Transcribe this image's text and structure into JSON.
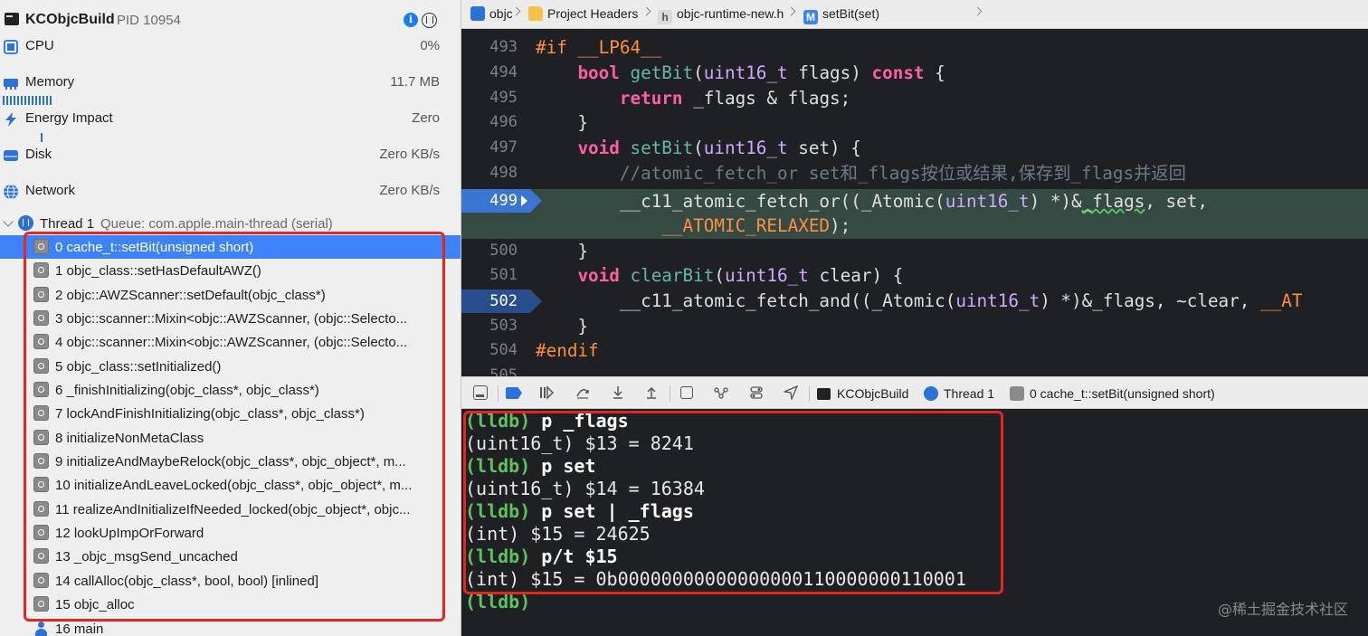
{
  "process": {
    "name": "KCObjcBuild",
    "pid": "PID 10954"
  },
  "gauges": [
    {
      "label": "CPU",
      "value": "0%",
      "icon": "cpu-icon"
    },
    {
      "label": "Memory",
      "value": "11.7 MB",
      "icon": "memory-icon"
    },
    {
      "label": "Energy Impact",
      "value": "Zero",
      "icon": "bolt-icon"
    },
    {
      "label": "Disk",
      "value": "Zero KB/s",
      "icon": "disk-icon"
    },
    {
      "label": "Network",
      "value": "Zero KB/s",
      "icon": "globe-icon"
    }
  ],
  "thread": {
    "title": "Thread 1",
    "queue": "Queue: com.apple.main-thread (serial)"
  },
  "frames": [
    "0 cache_t::setBit(unsigned short)",
    "1 objc_class::setHasDefaultAWZ()",
    "2 objc::AWZScanner::setDefault(objc_class*)",
    "3 objc::scanner::Mixin<objc::AWZScanner, (objc::Selecto...",
    "4 objc::scanner::Mixin<objc::AWZScanner, (objc::Selecto...",
    "5 objc_class::setInitialized()",
    "6 _finishInitializing(objc_class*, objc_class*)",
    "7 lockAndFinishInitializing(objc_class*, objc_class*)",
    "8 initializeNonMetaClass",
    "9 initializeAndMaybeRelock(objc_class*, objc_object*, m...",
    "10 initializeAndLeaveLocked(objc_class*, objc_object*, m...",
    "11 realizeAndInitializeIfNeeded_locked(objc_object*, objc...",
    "12 lookUpImpOrForward",
    "13 _objc_msgSend_uncached",
    "14 callAlloc(objc_class*, bool, bool) [inlined]",
    "15 objc_alloc",
    "16 main"
  ],
  "jumpbar": [
    "objc",
    "Project Headers",
    "objc-runtime-new.h",
    "setBit(set)"
  ],
  "code": {
    "line_numbers": [
      "493",
      "494",
      "495",
      "496",
      "497",
      "498",
      "499",
      "",
      "500",
      "501",
      "502",
      "503",
      "504",
      "505"
    ],
    "l493_pp": "#if __LP64__",
    "l494_kw": "bool",
    "l494_fn": "getBit",
    "l494_ty": "uint16_t",
    "l494_rest": " flags) ",
    "l494_const": "const",
    "l494_end": " {",
    "l495_kw": "return",
    "l495_rest": " _flags & flags;",
    "brace": "}",
    "l497_kw": "void",
    "l497_fn": "setBit",
    "l497_ty": "uint16_t",
    "l497_rest": " set) {",
    "l498_comment": "//atomic_fetch_or set和_flags按位或结果,保存到_flags并返回",
    "l499_a": "__c11_atomic_fetch_or((_Atomic(",
    "l499_ty": "uint16_t",
    "l499_b": ") *)&",
    "l499_u": "_flags",
    "l499_c": ", set,",
    "l499_macro": "__ATOMIC_RELAXED",
    "l499_end": ");",
    "l501_kw": "void",
    "l501_fn": "clearBit",
    "l501_ty": "uint16_t",
    "l501_rest": " clear) {",
    "l502_a": "__c11_atomic_fetch_and((_Atomic(",
    "l502_ty": "uint16_t",
    "l502_b": ") *)&_flags, ~clear, ",
    "l502_macro": "__AT",
    "l504_pp": "#endif"
  },
  "debugbar": {
    "process": "KCObjcBuild",
    "thread": "Thread 1",
    "frame": "0 cache_t::setBit(unsigned short)"
  },
  "console": {
    "prompt": "(lldb)",
    "cmd1": " p _flags",
    "out1": "(uint16_t) $13 = 8241",
    "cmd2": " p set",
    "out2": "(uint16_t) $14 = 16384",
    "cmd3": " p set | _flags",
    "out3": "(int) $15 = 24625",
    "cmd4": " p/t $15",
    "out4": "(int) $15 = 0b00000000000000000110000000110001"
  },
  "watermark": "@稀土掘金技术社区",
  "colors": {
    "accent": "#3d82f6",
    "annotation": "#e3261f",
    "prompt": "#5dc25f",
    "keyword": "#fc5fa3"
  }
}
